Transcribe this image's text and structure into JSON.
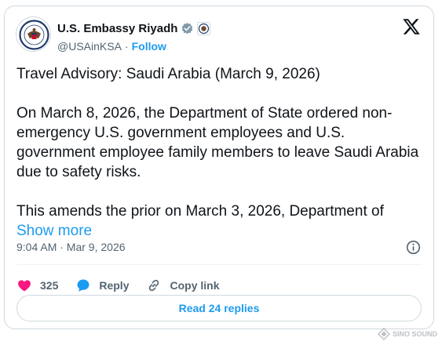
{
  "tweet": {
    "display_name": "U.S. Embassy Riyadh",
    "handle": "@USAinKSA",
    "separator": "·",
    "follow_label": "Follow",
    "paragraph_1": "Travel Advisory: Saudi Arabia (March 9, 2026)",
    "paragraph_2": "On March 8, 2026, the Department of State ordered non-emergency U.S. government employees and U.S. government employee family members to leave Saudi Arabia due to safety risks.",
    "paragraph_3_start": "This amends the prior on March 3, 2026, Department of",
    "show_more_label": "Show more",
    "timestamp": "9:04 AM · Mar 9, 2026"
  },
  "actions": {
    "like_count": "325",
    "reply_label": "Reply",
    "copy_link_label": "Copy link"
  },
  "replies": {
    "read_label": "Read 24 replies"
  },
  "watermark": {
    "line1": "SINO SOUND"
  },
  "colors": {
    "accent": "#1d9bf0",
    "like": "#f91880",
    "text": "#0f1419",
    "muted": "#536471",
    "border": "#cfd9de"
  },
  "icons": {
    "avatar": "embassy-seal-avatar",
    "verified": "verified-badge-icon",
    "affiliation": "government-seal-icon",
    "logo": "x-logo-icon",
    "info": "info-icon",
    "like": "heart-icon",
    "reply": "reply-bubble-icon",
    "copy_link": "link-icon"
  }
}
